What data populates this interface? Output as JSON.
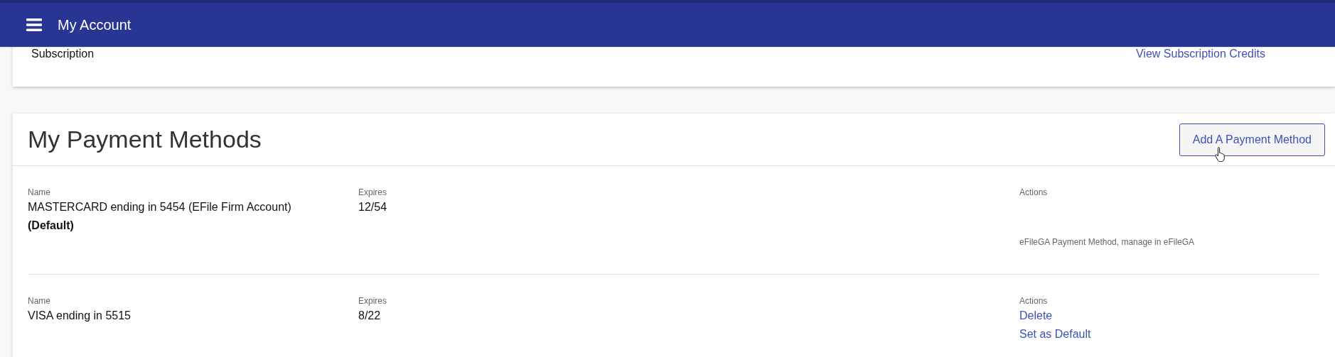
{
  "header": {
    "title": "My Account"
  },
  "subscription_card": {
    "label": "Subscription",
    "link": "View Subscription Credits"
  },
  "payment_methods": {
    "title": "My Payment Methods",
    "add_button": "Add A Payment Method",
    "rows": [
      {
        "name_label": "Name",
        "expires_label": "Expires",
        "actions_label": "Actions",
        "name": "MASTERCARD ending in 5454 (EFile Firm Account)",
        "default_label": "(Default)",
        "expires": "12/54",
        "note": "eFileGA Payment Method, manage in eFileGA"
      },
      {
        "name_label": "Name",
        "expires_label": "Expires",
        "actions_label": "Actions",
        "name": "VISA ending in 5515",
        "expires": "8/22",
        "actions": [
          "Delete",
          "Set as Default"
        ]
      }
    ]
  }
}
